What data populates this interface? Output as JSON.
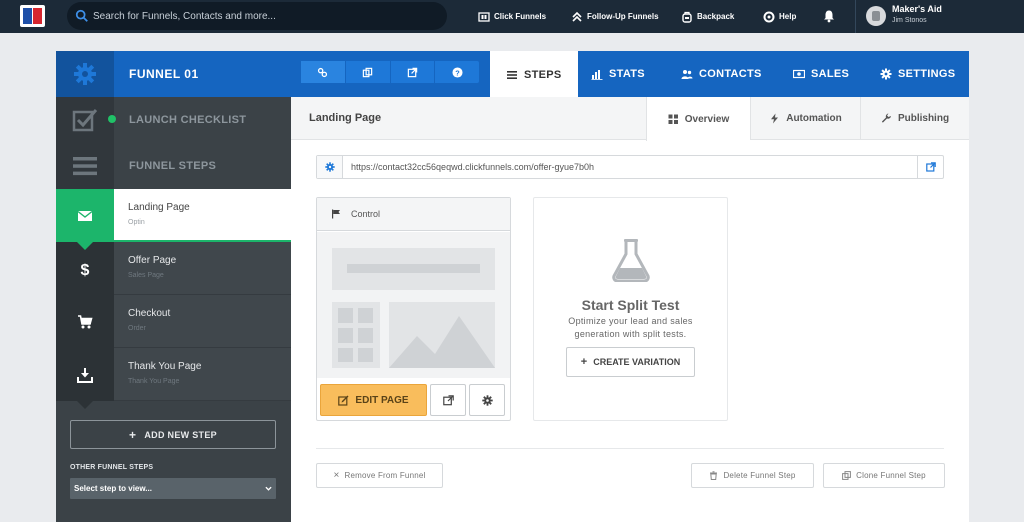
{
  "topbar": {
    "search_placeholder": "Search for Funnels, Contacts and more...",
    "nav": [
      {
        "label": "Click Funnels"
      },
      {
        "label": "Follow-Up Funnels"
      },
      {
        "label": "Backpack"
      },
      {
        "label": "Help"
      }
    ],
    "user": {
      "name": "Maker's Aid",
      "subtitle": "Jim Stonos"
    }
  },
  "funnel_header": {
    "title": "FUNNEL 01",
    "tabs": [
      {
        "label": "STEPS",
        "icon": "list-icon",
        "active": true
      },
      {
        "label": "STATS",
        "icon": "bar-chart-icon"
      },
      {
        "label": "CONTACTS",
        "icon": "users-icon"
      },
      {
        "label": "SALES",
        "icon": "money-icon"
      },
      {
        "label": "SETTINGS",
        "icon": "gear-icon"
      }
    ]
  },
  "sidebar": {
    "launch_checklist": "LAUNCH CHECKLIST",
    "funnel_steps": "FUNNEL STEPS",
    "steps": [
      {
        "name": "Landing Page",
        "type": "Optin",
        "icon": "envelope-icon",
        "active": true
      },
      {
        "name": "Offer Page",
        "type": "Sales Page",
        "icon": "dollar-icon"
      },
      {
        "name": "Checkout",
        "type": "Order",
        "icon": "cart-icon"
      },
      {
        "name": "Thank You Page",
        "type": "Thank You Page",
        "icon": "download-icon"
      }
    ],
    "add_new_step": "ADD NEW STEP",
    "other_steps_label": "OTHER FUNNEL STEPS",
    "select_value": "Select step to view..."
  },
  "main": {
    "title": "Landing Page",
    "tabs": [
      {
        "label": "Overview",
        "icon": "grid-icon",
        "active": true
      },
      {
        "label": "Automation",
        "icon": "bolt-icon"
      },
      {
        "label": "Publishing",
        "icon": "wrench-icon"
      }
    ],
    "url": "https://contact32cc56qeqwd.clickfunnels.com/offer-gyue7b0h",
    "control_label": "Control",
    "edit_page": "EDIT PAGE",
    "split": {
      "title": "Start Split Test",
      "description": "Optimize your lead and sales generation with split tests.",
      "button": "CREATE VARIATION"
    },
    "footer": {
      "remove": "Remove From Funnel",
      "delete": "Delete Funnel Step",
      "clone": "Clone Funnel Step"
    }
  },
  "colors": {
    "topbar": "#1c2a38",
    "header_blue": "#1565c0",
    "sidebar": "#3b4247",
    "active_green": "#1cb56b",
    "edit_orange": "#f9bd5c"
  }
}
